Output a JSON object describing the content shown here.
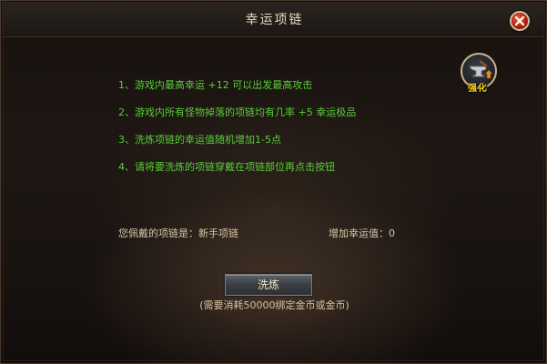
{
  "window": {
    "title": "幸运项链"
  },
  "icons": {
    "close": "close-icon",
    "enhance": "anvil-enhance-icon"
  },
  "enhance_label": "强化",
  "rules": [
    "1、游戏内最高幸运 +12 可以出发最高攻击",
    "2、游戏内所有怪物掉落的项链均有几率 +5 幸运极品",
    "3、洗炼项链的幸运值随机增加1-5点",
    "4、请将要洗炼的项链穿戴在项链部位再点击按钮"
  ],
  "info": {
    "equipped_label": "您佩戴的项链是：新手项链",
    "luck_bonus_label": "增加幸运值：0"
  },
  "refine_button": {
    "label": "洗炼",
    "cost_note": "(需要消耗50000绑定金币或金币)"
  },
  "colors": {
    "rule_text": "#59ce3a",
    "info_text": "#d9c8a8",
    "title_text": "#e7d9c3",
    "close_red": "#b21e10",
    "enhance_label": "#ffd21c"
  }
}
